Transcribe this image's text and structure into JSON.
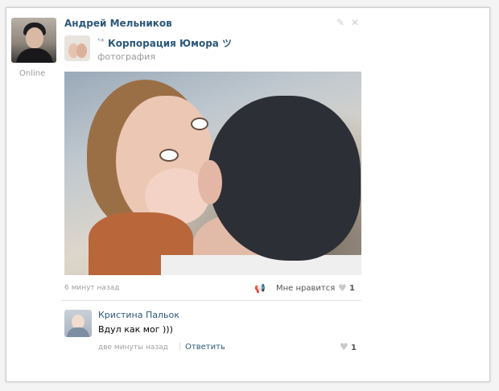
{
  "post": {
    "author": "Андрей Мельников",
    "status": "Online",
    "edit_icon": "✎",
    "close_icon": "✕",
    "repost": {
      "icon": "↪",
      "source": "Корпорация Юмора ツ",
      "type": "фотография"
    },
    "time": "6 минут назад",
    "share_icon": "📢",
    "like_label": "Мне нравится",
    "like_icon": "♥",
    "like_count": "1"
  },
  "comment": {
    "author": "Кристина Пальок",
    "text": "Вдул как мог )))",
    "time": "две минуты назад",
    "separator": "|",
    "reply_label": "Ответить",
    "like_icon": "♥",
    "like_count": "1"
  }
}
